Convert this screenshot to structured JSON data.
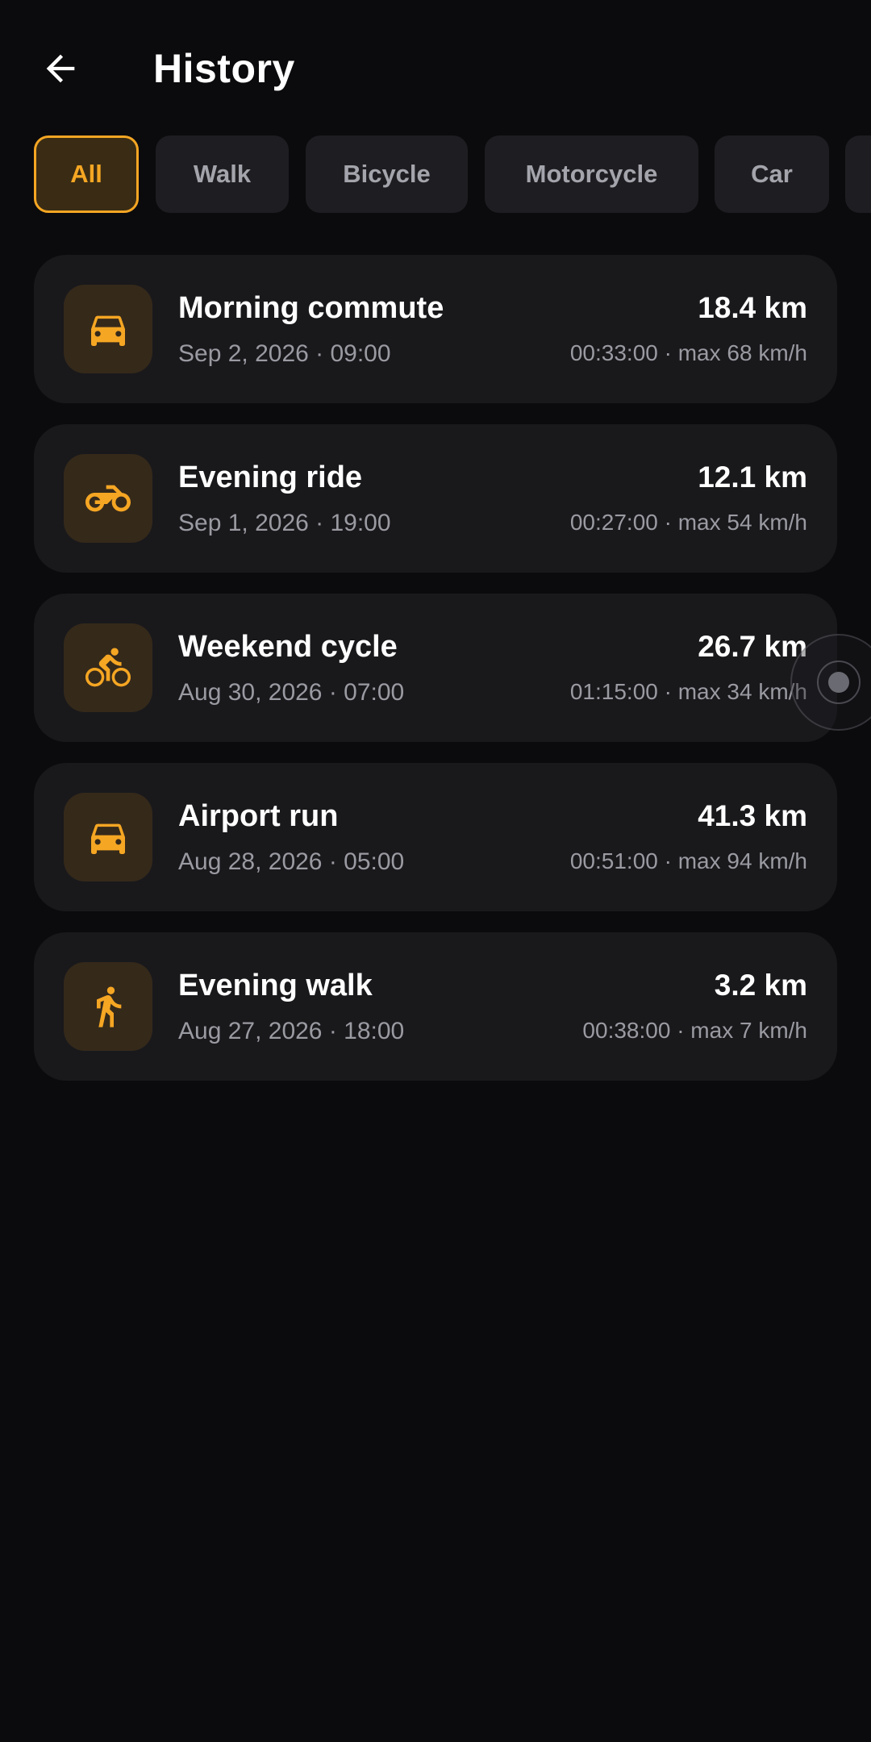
{
  "header": {
    "title": "History",
    "back_icon": "arrow-back-icon"
  },
  "filters": [
    {
      "label": "All",
      "active": true
    },
    {
      "label": "Walk",
      "active": false
    },
    {
      "label": "Bicycle",
      "active": false
    },
    {
      "label": "Motorcycle",
      "active": false
    },
    {
      "label": "Car",
      "active": false
    }
  ],
  "trips": [
    {
      "name": "Morning commute",
      "date": "Sep 2, 2026 · 09:00",
      "distance": "18.4 km",
      "stats": "00:33:00 · max 68 km/h",
      "icon": "car-icon"
    },
    {
      "name": "Evening ride",
      "date": "Sep 1, 2026 · 19:00",
      "distance": "12.1 km",
      "stats": "00:27:00 · max 54 km/h",
      "icon": "motorcycle-icon"
    },
    {
      "name": "Weekend cycle",
      "date": "Aug 30, 2026 · 07:00",
      "distance": "26.7 km",
      "stats": "01:15:00 · max 34 km/h",
      "icon": "bicycle-icon"
    },
    {
      "name": "Airport run",
      "date": "Aug 28, 2026 · 05:00",
      "distance": "41.3 km",
      "stats": "00:51:00 · max 94 km/h",
      "icon": "car-icon"
    },
    {
      "name": "Evening walk",
      "date": "Aug 27, 2026 · 18:00",
      "distance": "3.2 km",
      "stats": "00:38:00 · max 7 km/h",
      "icon": "walk-icon"
    }
  ],
  "colors": {
    "background": "#0b0b0d",
    "card": "#19191c",
    "accent": "#f5a623",
    "icon_bg": "#35291a",
    "muted_text": "#9a9aa2"
  }
}
